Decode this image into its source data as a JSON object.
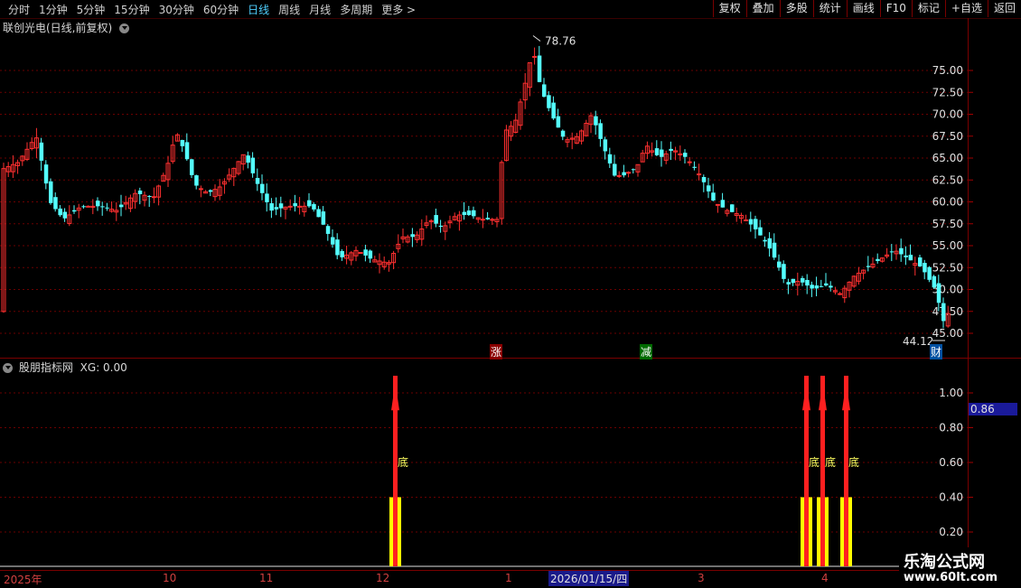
{
  "toolbar": {
    "periods": [
      "分时",
      "1分钟",
      "5分钟",
      "15分钟",
      "30分钟",
      "60分钟",
      "日线",
      "周线",
      "月线",
      "多周期",
      "更多 >"
    ],
    "active_period": "日线",
    "actions": [
      "复权",
      "叠加",
      "多股",
      "统计",
      "画线",
      "F10",
      "标记",
      "+自选",
      "返回"
    ]
  },
  "main_chart": {
    "title": "联创光电(日线,前复权)",
    "high_label": "78.76",
    "low_label": "44.12",
    "y_ticks": [
      "75.00",
      "72.50",
      "70.00",
      "67.50",
      "65.00",
      "62.50",
      "60.00",
      "57.50",
      "55.00",
      "52.50",
      "50.00",
      "47.50",
      "45.00"
    ],
    "markers": {
      "zhang": "涨",
      "jian": "减",
      "cai": "财"
    }
  },
  "indicator": {
    "title": "股朋指标网",
    "xg_label": "XG: 0.00",
    "y_ticks": [
      "1.00",
      "0.80",
      "0.60",
      "0.40",
      "0.20"
    ],
    "current_value": "0.86",
    "signal_label": "底",
    "colors": {
      "up": "#ff2020",
      "base": "#ffff00"
    }
  },
  "xaxis": {
    "labels": [
      "2025年",
      "10",
      "11",
      "12",
      "1",
      "2",
      "3",
      "4"
    ],
    "cursor_date": "2026/01/15/四"
  },
  "watermark": {
    "line1": "乐淘公式网",
    "line2": "www.60lt.com"
  },
  "colors": {
    "up": "#ff3030",
    "down": "#54ffff",
    "grid": "#7a0000"
  }
}
